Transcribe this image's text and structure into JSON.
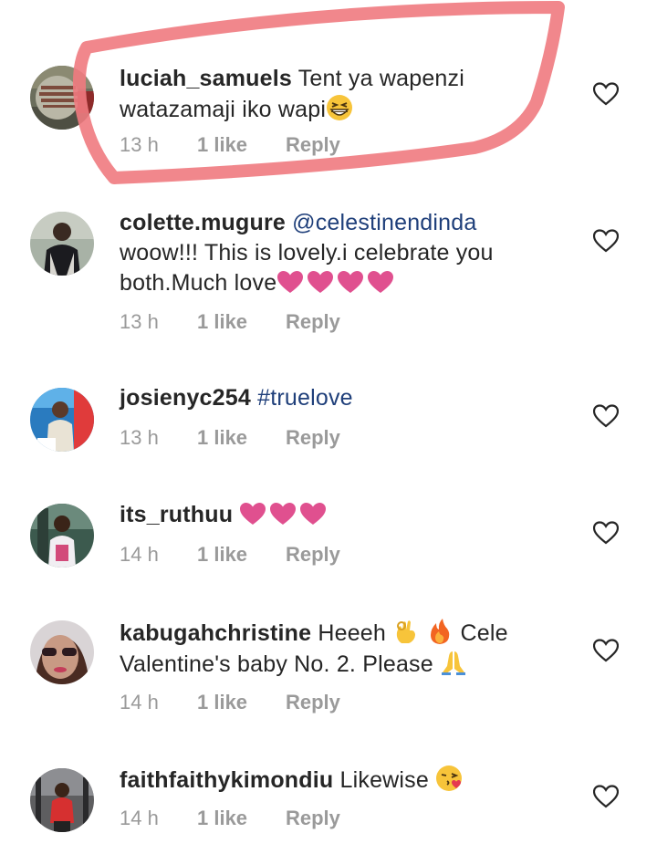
{
  "comments": [
    {
      "username": "luciah_samuels",
      "text_line1": " Tent ya wapenzi",
      "text_line2": "watazamaji iko wapi",
      "time": "13 h",
      "likes": "1 like",
      "reply": "Reply",
      "emoji": "grinning-squinting-face"
    },
    {
      "username": "colette.mugure",
      "mention": " @celestinendinda",
      "text_line2": "woow!!! This is lovely.i celebrate you",
      "text_line3": "both.Much love",
      "time": "13 h",
      "likes": "1 like",
      "reply": "Reply",
      "emoji": "pink-heart x4"
    },
    {
      "username": "josienyc254",
      "mention": " #truelove",
      "time": "13 h",
      "likes": "1 like",
      "reply": "Reply"
    },
    {
      "username": "its_ruthuu",
      "time": "14 h",
      "likes": "1 like",
      "reply": "Reply",
      "emoji": "pink-heart x3"
    },
    {
      "username": "kabugahchristine",
      "text_line1a": " Heeeh ",
      "text_line1b": " Cele",
      "text_line2": "Valentine's baby No. 2.  Please ",
      "time": "14 h",
      "likes": "1 like",
      "reply": "Reply",
      "emoji": "ok-hand, fire, folded-hands"
    },
    {
      "username": "faithfaithykimondiu",
      "text_line1": " Likewise ",
      "time": "14 h",
      "likes": "1 like",
      "reply": "Reply",
      "emoji": "face-blowing-a-kiss"
    }
  ],
  "colors": {
    "text": "#262626",
    "meta": "#9a9a9a",
    "mention": "#1f3f7a",
    "heart_emoji": "#e0508f",
    "annotation_marker": "#f07a7f"
  },
  "icons": {
    "like_button": "heart-outline-icon"
  }
}
